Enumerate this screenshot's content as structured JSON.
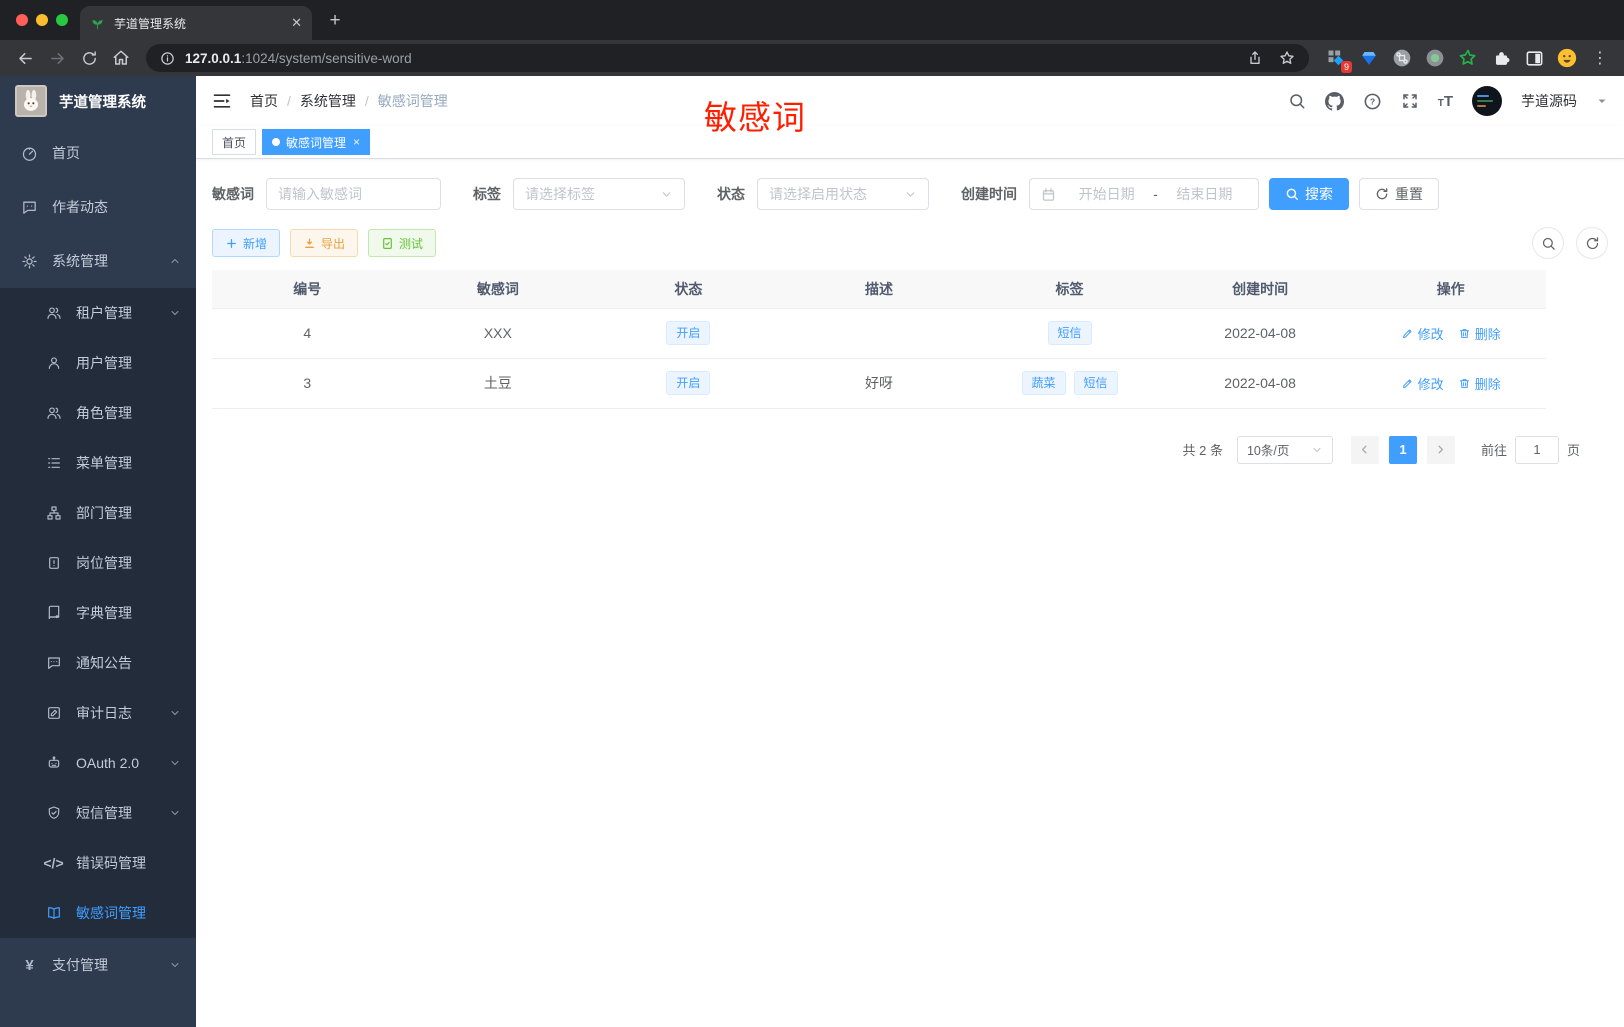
{
  "browser": {
    "tab_title": "芋道管理系统",
    "new_tab_label": "+",
    "close_label": "✕",
    "url_host": "127.0.0.1",
    "url_rest": ":1024/system/sensitive-word",
    "extension_badge": "9",
    "menu_dots": "⋮"
  },
  "annotation": {
    "text": "敏感词",
    "color": "#ff1f00"
  },
  "sidebar": {
    "logo_title": "芋道管理系统",
    "items": [
      {
        "id": "home",
        "icon": "dashboard-icon",
        "label": "首页",
        "level": 0
      },
      {
        "id": "author-news",
        "icon": "chat-icon",
        "label": "作者动态",
        "level": 0
      },
      {
        "id": "system",
        "icon": "gear-icon",
        "label": "系统管理",
        "level": 0,
        "chevron": "up"
      },
      {
        "id": "tenant",
        "icon": "users-icon",
        "label": "租户管理",
        "level": 1,
        "chevron": "down"
      },
      {
        "id": "user",
        "icon": "user-icon",
        "label": "用户管理",
        "level": 1
      },
      {
        "id": "role",
        "icon": "user-group-icon",
        "label": "角色管理",
        "level": 1
      },
      {
        "id": "menu",
        "icon": "tree-icon",
        "label": "菜单管理",
        "level": 1
      },
      {
        "id": "dept",
        "icon": "org-icon",
        "label": "部门管理",
        "level": 1
      },
      {
        "id": "post",
        "icon": "badge-icon",
        "label": "岗位管理",
        "level": 1
      },
      {
        "id": "dict",
        "icon": "book-icon",
        "label": "字典管理",
        "level": 1
      },
      {
        "id": "notice",
        "icon": "chat-dots-icon",
        "label": "通知公告",
        "level": 1
      },
      {
        "id": "audit-log",
        "icon": "edit-note-icon",
        "label": "审计日志",
        "level": 1,
        "chevron": "down"
      },
      {
        "id": "oauth",
        "icon": "robot-icon",
        "label": "OAuth 2.0",
        "level": 1,
        "chevron": "down"
      },
      {
        "id": "sms",
        "icon": "shield-icon",
        "label": "短信管理",
        "level": 1,
        "chevron": "down"
      },
      {
        "id": "error-code",
        "icon": "code-icon",
        "label": "错误码管理",
        "level": 1
      },
      {
        "id": "sensitive-word",
        "icon": "open-book-icon",
        "label": "敏感词管理",
        "level": 1,
        "active": true
      },
      {
        "id": "pay",
        "icon": "yen-icon",
        "label": "支付管理",
        "level": 0,
        "chevron": "down"
      }
    ]
  },
  "header": {
    "breadcrumb": [
      "首页",
      "系统管理",
      "敏感词管理"
    ],
    "username": "芋道源码"
  },
  "tags": [
    {
      "label": "首页",
      "active": false,
      "closable": false
    },
    {
      "label": "敏感词管理",
      "active": true,
      "closable": true
    }
  ],
  "filters": {
    "keyword_label": "敏感词",
    "keyword_placeholder": "请输入敏感词",
    "tag_label": "标签",
    "tag_placeholder": "请选择标签",
    "status_label": "状态",
    "status_placeholder": "请选择启用状态",
    "date_label": "创建时间",
    "date_start_placeholder": "开始日期",
    "date_separator": "-",
    "date_end_placeholder": "结束日期",
    "search_label": "搜索",
    "reset_label": "重置"
  },
  "actions": {
    "add_label": "新增",
    "export_label": "导出",
    "test_label": "测试"
  },
  "table": {
    "columns": [
      "编号",
      "敏感词",
      "状态",
      "描述",
      "标签",
      "创建时间",
      "操作"
    ],
    "rows": [
      {
        "id": "4",
        "word": "XXX",
        "status": "开启",
        "description": "",
        "tags": [
          "短信"
        ],
        "created": "2022-04-08"
      },
      {
        "id": "3",
        "word": "土豆",
        "status": "开启",
        "description": "好呀",
        "tags": [
          "蔬菜",
          "短信"
        ],
        "created": "2022-04-08"
      }
    ],
    "edit_label": "修改",
    "delete_label": "删除"
  },
  "pagination": {
    "total_text": "共 2 条",
    "page_size": "10条/页",
    "current_page": "1",
    "goto_label": "前往",
    "goto_value": "1",
    "unit_label": "页"
  },
  "colors": {
    "accent": "#409eff",
    "warning": "#e6a23c",
    "success": "#67c23a",
    "sidebar_bg": "#2e3a4e",
    "submenu_bg": "#232c3b",
    "annotation": "#ff1f00"
  }
}
